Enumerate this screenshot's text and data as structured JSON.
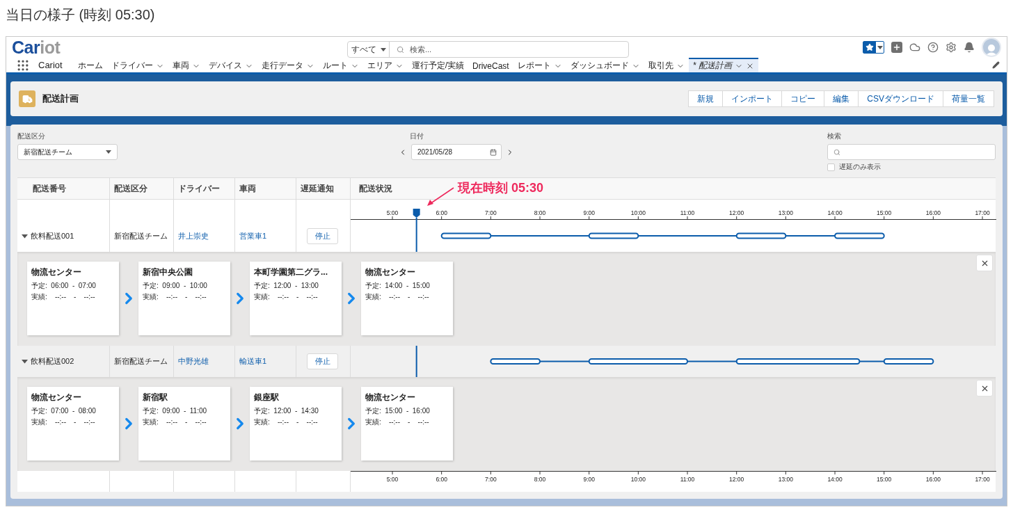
{
  "page_title": "当日の様子 (時刻 05:30)",
  "header": {
    "logo": {
      "primary": "Car",
      "secondary": "iot"
    },
    "search": {
      "scope": "すべて",
      "placeholder": "検索..."
    }
  },
  "nav": {
    "app_name": "Cariot",
    "items": [
      {
        "label": "ホーム",
        "has_menu": false,
        "selected": false
      },
      {
        "label": "ドライバー",
        "has_menu": true,
        "selected": false
      },
      {
        "label": "車両",
        "has_menu": true,
        "selected": false
      },
      {
        "label": "デバイス",
        "has_menu": true,
        "selected": false
      },
      {
        "label": "走行データ",
        "has_menu": true,
        "selected": false
      },
      {
        "label": "ルート",
        "has_menu": true,
        "selected": false
      },
      {
        "label": "エリア",
        "has_menu": true,
        "selected": false
      },
      {
        "label": "運行予定/実績",
        "has_menu": false,
        "selected": false
      },
      {
        "label": "DriveCast",
        "has_menu": false,
        "selected": false
      },
      {
        "label": "レポート",
        "has_menu": true,
        "selected": false
      },
      {
        "label": "ダッシュボード",
        "has_menu": true,
        "selected": false
      },
      {
        "label": "取引先",
        "has_menu": true,
        "selected": false
      },
      {
        "label": "* 配送計画",
        "has_menu": true,
        "selected": true
      }
    ]
  },
  "page_header": {
    "title": "配送計画",
    "actions": [
      "新規",
      "インポート",
      "コピー",
      "編集",
      "CSVダウンロード",
      "荷量一覧"
    ]
  },
  "filters": {
    "category": {
      "label": "配送区分",
      "value": "新宿配送チーム"
    },
    "date": {
      "label": "日付",
      "value": "2021/05/28"
    },
    "search": {
      "label": "検索"
    },
    "delay_only": {
      "label": "遅延のみ表示",
      "checked": false
    }
  },
  "table": {
    "columns": [
      "配送番号",
      "配送区分",
      "ドライバー",
      "車両",
      "遅延通知",
      "配送状況"
    ],
    "now_marker": {
      "label": "現在時刻 05:30",
      "level": 0.102
    },
    "top_axis": [
      "5:00",
      "6:00",
      "7:00",
      "8:00",
      "9:00",
      "10:00",
      "11:00",
      "12:00",
      "13:00",
      "14:00",
      "15:00",
      "16:00",
      "17:00"
    ],
    "rows": [
      {
        "number": "飲料配送001",
        "category": "新宿配送チーム",
        "driver": "井上崇史",
        "vehicle": "営業車1",
        "action": "停止",
        "expanded": true,
        "highlighted": false,
        "stops": [
          {
            "name": "物流センター",
            "planned": "予定:  06:00  -  07:00",
            "actual": "実績:    --:--    -    --:--"
          },
          {
            "name": "新宿中央公園",
            "planned": "予定:  09:00  -  10:00",
            "actual": "実績:    --:--    -    --:--"
          },
          {
            "name": "本町学園第二グラ...",
            "planned": "予定:  12:00  -  13:00",
            "actual": "実績:    --:--    -    --:--"
          },
          {
            "name": "物流センター",
            "planned": "予定:  14:00  -  15:00",
            "actual": "実績:    --:--    -    --:--"
          }
        ]
      },
      {
        "number": "飲料配送002",
        "category": "新宿配送チーム",
        "driver": "中野光雄",
        "vehicle": "輸送車1",
        "action": "停止",
        "expanded": true,
        "highlighted": true,
        "stops": [
          {
            "name": "物流センター",
            "planned": "予定:  07:00  -  08:00",
            "actual": "実績:    --:--    -    --:--"
          },
          {
            "name": "新宿駅",
            "planned": "予定:  09:00  -  11:00",
            "actual": "実績:    --:--    -    --:--"
          },
          {
            "name": "銀座駅",
            "planned": "予定:  12:00  -  14:30",
            "actual": "実績:    --:--    -    --:--"
          },
          {
            "name": "物流センター",
            "planned": "予定:  15:00  -  16:00",
            "actual": "実績:    --:--    -    --:--"
          }
        ]
      }
    ],
    "bottom_axis": [
      "5:00",
      "6:00",
      "7:00",
      "8:00",
      "9:00",
      "10:00",
      "11:00",
      "12:00",
      "13:00",
      "14:00",
      "15:00",
      "16:00",
      "17:00"
    ]
  }
}
